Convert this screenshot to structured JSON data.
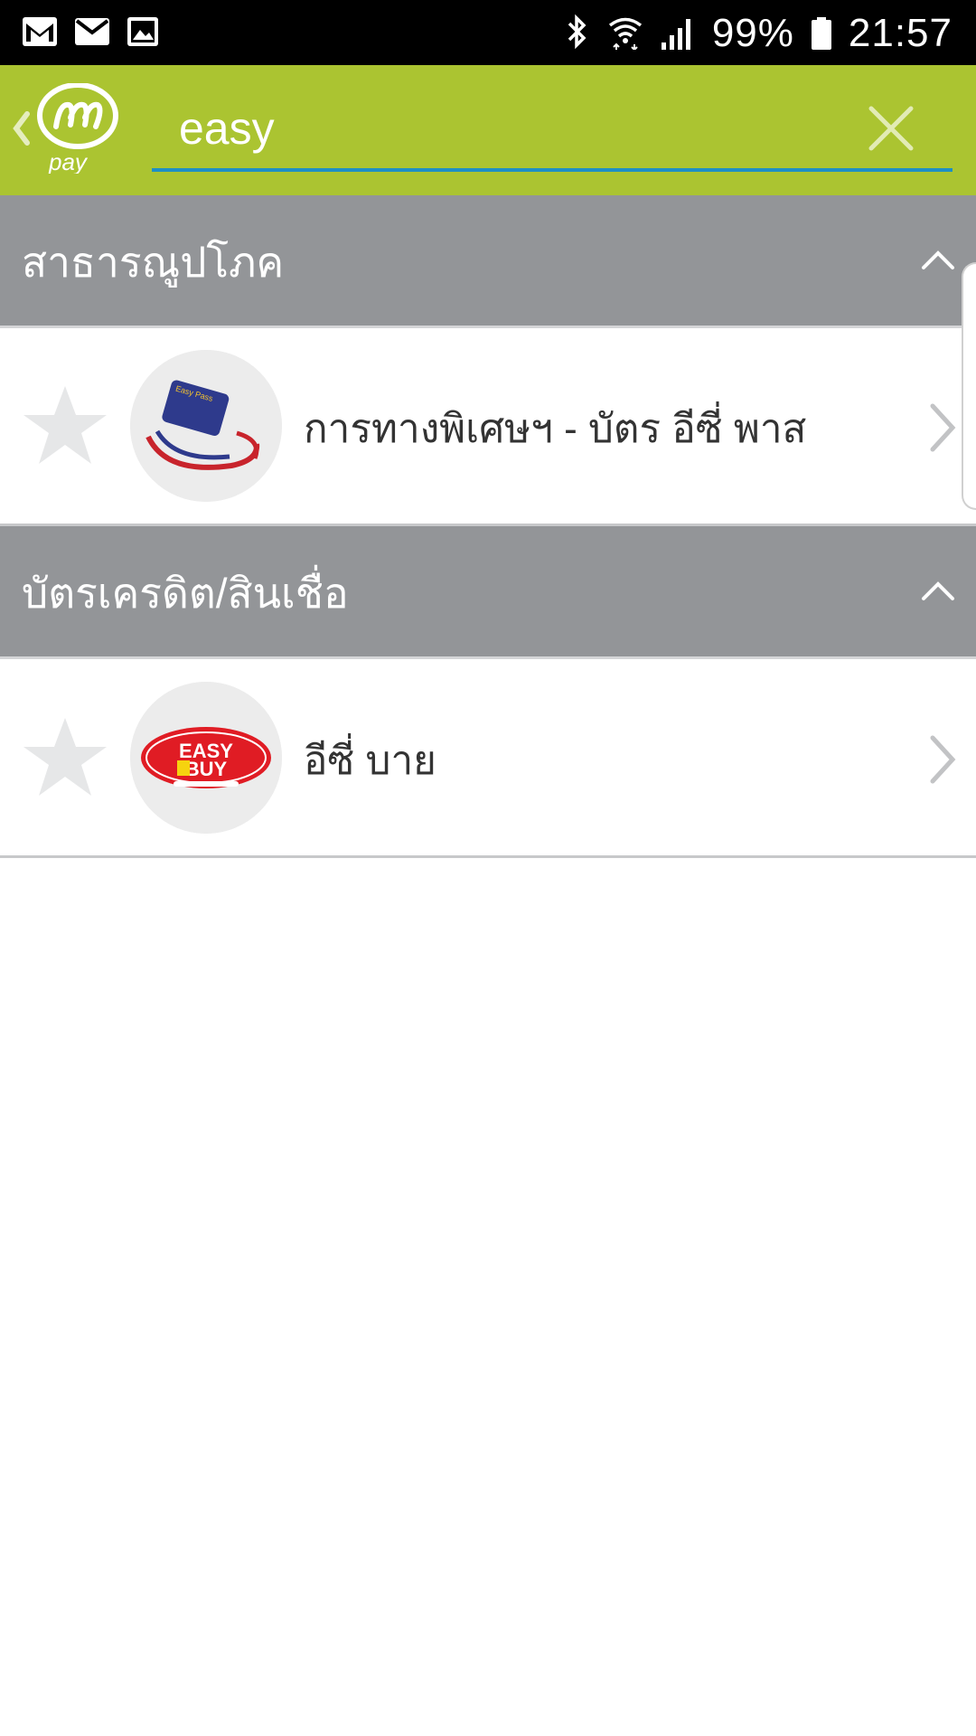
{
  "status_bar": {
    "battery": "99%",
    "time": "21:57",
    "left_icons": [
      "gmail-icon",
      "mail-icon",
      "gallery-icon"
    ],
    "right_icons": [
      "bluetooth-icon",
      "wifi-icon",
      "signal-icon",
      "battery-icon"
    ]
  },
  "header": {
    "logo_text": "pay",
    "search": {
      "value": "easy",
      "placeholder": ""
    },
    "accent_color": "#abc431",
    "underline_color": "#1d8fc4"
  },
  "sections": [
    {
      "title": "สาธารณูปโภค",
      "items": [
        {
          "label": "การทางพิเศษฯ - บัตร อีซี่ พาส",
          "icon": "easy-pass-card-icon"
        }
      ]
    },
    {
      "title": "บัตรเครดิต/สินเชื่อ",
      "items": [
        {
          "label": "อีซี่ บาย",
          "icon": "easy-buy-logo",
          "logo_line1": "EASY",
          "logo_line2": "BUY"
        }
      ]
    }
  ]
}
